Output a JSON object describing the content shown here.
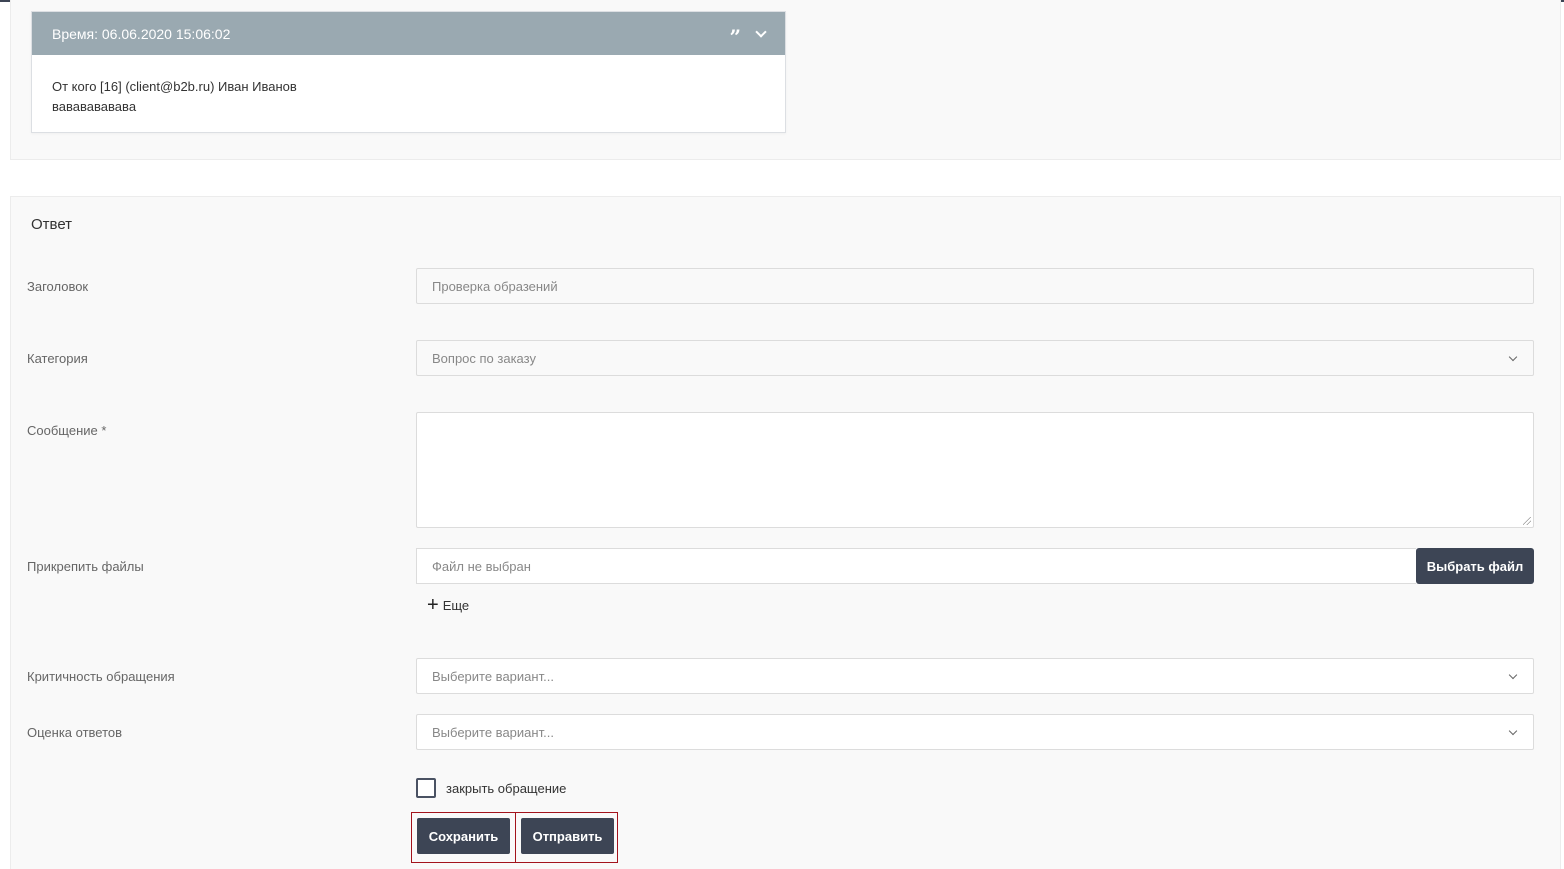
{
  "message": {
    "time": "Время: 06.06.2020 15:06:02",
    "from": "От кого [16] (client@b2b.ru) Иван Иванов",
    "text": "вавававававa"
  },
  "reply": {
    "title": "Ответ",
    "fields": {
      "subject_label": "Заголовок",
      "subject_value": "Проверка образений",
      "category_label": "Категория",
      "category_value": "Вопрос по заказу",
      "message_label": "Сообщение *",
      "attach_label": "Прикрепить файлы",
      "file_placeholder": "Файл не выбран",
      "choose_file_label": "Выбрать файл",
      "more_label": "Еще",
      "criticality_label": "Критичность обращения",
      "criticality_value": "Выберите вариант...",
      "rating_label": "Оценка ответов",
      "rating_value": "Выберите вариант...",
      "close_checkbox_label": "закрыть обращение"
    },
    "buttons": {
      "save_label": "Сохранить",
      "send_label": "Отправить"
    }
  },
  "icons": {
    "quote": "quote-icon",
    "chevron": "chevron-down-icon",
    "plus": "plus-icon"
  },
  "colors": {
    "header_bg": "#9aa9b1",
    "button_bg": "#3d4555",
    "highlight_border": "#a3131c"
  }
}
